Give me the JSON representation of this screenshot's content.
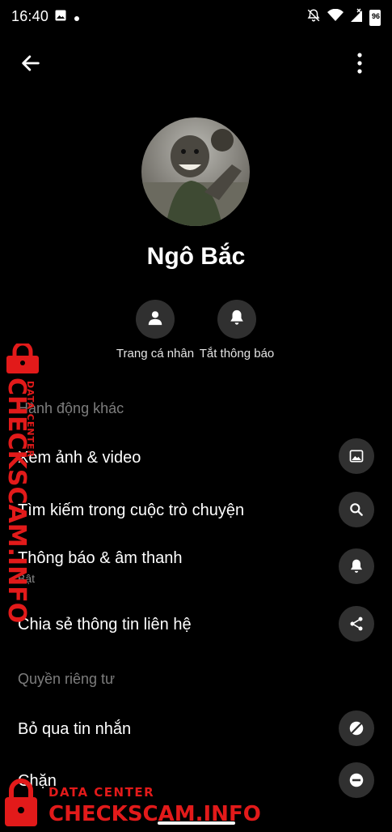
{
  "status_bar": {
    "time": "16:40",
    "battery": "96",
    "icons": [
      "image-icon",
      "dot-icon",
      "bell-off-icon",
      "wifi-icon",
      "signal-icon",
      "battery-icon"
    ]
  },
  "header": {
    "back_icon": "arrow-left-icon",
    "more_icon": "more-vertical-icon"
  },
  "profile": {
    "name": "Ngô Bắc"
  },
  "quick_actions": [
    {
      "label": "Trang cá nhân",
      "icon": "person-icon"
    },
    {
      "label": "Tắt thông báo",
      "icon": "bell-icon"
    }
  ],
  "sections": {
    "more_actions": "Hành động khác",
    "privacy": "Quyền riêng tư"
  },
  "rows": {
    "media": {
      "label": "Xem ảnh & video",
      "icon": "image-icon"
    },
    "search": {
      "label": "Tìm kiếm trong cuộc trò chuyện",
      "icon": "search-icon"
    },
    "notifications": {
      "label": "Thông báo & âm thanh",
      "sub": "Bật",
      "icon": "bell-icon"
    },
    "share": {
      "label": "Chia sẻ thông tin liên hệ",
      "icon": "share-icon"
    },
    "ignore": {
      "label": "Bỏ qua tin nhắn",
      "icon": "chat-off-icon"
    },
    "block": {
      "label": "Chặn",
      "icon": "block-icon"
    }
  },
  "watermark": {
    "brand": "CHECKSCAM.INFO",
    "tag": "DATA CENTER",
    "color": "#e21a1a"
  },
  "colors": {
    "background": "#000000",
    "icon_circle": "#303030",
    "muted_text": "#7d7d7d"
  }
}
